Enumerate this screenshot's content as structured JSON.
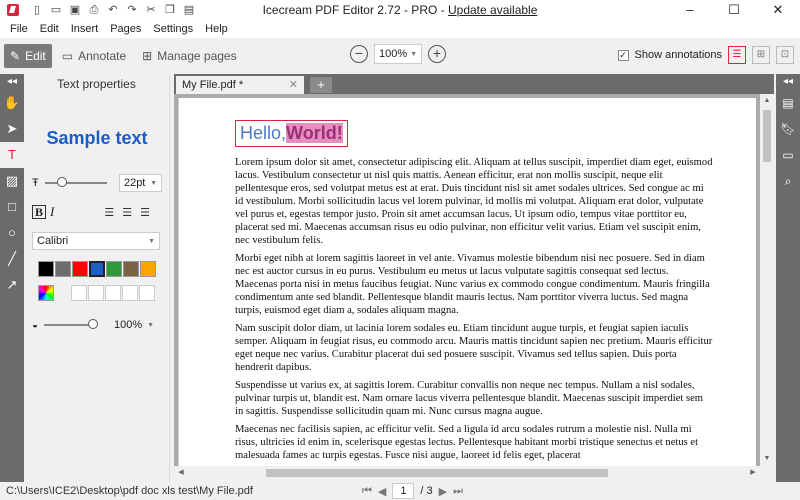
{
  "window": {
    "title": "Icecream PDF Editor 2.72 - PRO - ",
    "update_link": "Update available"
  },
  "menu": [
    "File",
    "Edit",
    "Insert",
    "Pages",
    "Settings",
    "Help"
  ],
  "toolbar": {
    "edit_label": "Edit",
    "annotate_label": "Annotate",
    "manage_pages_label": "Manage pages",
    "zoom_value": "100%",
    "show_annotations_label": "Show annotations"
  },
  "text_properties": {
    "title": "Text properties",
    "sample_text": "Sample text",
    "font_size": "22pt",
    "font_family": "Calibri",
    "opacity": "100%",
    "swatch_colors": [
      "#000000",
      "#6d6d6d",
      "#ff0000",
      "#1f5fc9",
      "#2e9a3a",
      "#7b6446",
      "#ffa500"
    ]
  },
  "tab": {
    "name": "My File.pdf *"
  },
  "document": {
    "hello_text": "Hello,",
    "world_text": "World!",
    "paragraphs": [
      "Lorem ipsum dolor sit amet, consectetur adipiscing elit. Aliquam at tellus suscipit, imperdiet diam eget, euismod lacus. Vestibulum consectetur ut nisl quis mattis. Aenean efficitur, erat non mollis suscipit, neque elit pellentesque eros, sed volutpat metus est at erat. Duis tincidunt nisl sit amet sodales ultrices. Sed congue ac mi id vestibulum. Morbi sollicitudin lacus vel lorem pulvinar, id mollis mi volutpat. Aliquam erat dolor, vulputate vel purus et, egestas tempor justo. Proin sit amet accumsan lacus. Ut ipsum odio, tempus vitae porttitor eu, placerat sed mi. Maecenas accumsan risus eu odio pulvinar, non efficitur velit varius. Etiam vel suscipit enim, nec vestibulum felis.",
      "Morbi eget nibh at lorem sagittis laoreet in vel ante. Vivamus molestie bibendum nisi nec posuere. Sed in diam nec est auctor cursus in eu purus. Vestibulum eu metus ut lacus vulputate sagittis consequat sed lectus. Maecenas porta nisi in metus faucibus feugiat. Nunc varius ex commodo congue condimentum. Mauris fringilla condimentum ante sed blandit. Pellentesque blandit mauris lectus. Nam porttitor viverra luctus. Sed magna turpis, euismod eget diam a, sodales aliquam magna.",
      "Nam suscipit dolor diam, ut lacinia lorem sodales eu. Etiam tincidunt augue turpis, et feugiat sapien iaculis semper. Aliquam in feugiat risus, eu commodo arcu. Mauris mattis tincidunt sapien nec pretium. Mauris efficitur eget neque nec varius. Curabitur placerat dui sed posuere suscipit. Vivamus sed tellus sapien. Duis porta hendrerit dapibus.",
      "Suspendisse ut varius ex, at sagittis lorem. Curabitur convallis non neque nec tempus. Nullam a nisl sodales, pulvinar turpis ut, blandit est. Nam ornare lacus viverra pellentesque blandit. Maecenas suscipit imperdiet sem in sagittis. Suspendisse sollicitudin quam mi. Nunc cursus magna augue.",
      "Maecenas nec facilisis sapien, ac efficitur velit. Sed a ligula id arcu sodales rutrum a molestie nisl. Nulla mi risus, ultricies id enim in, scelerisque egestas lectus. Pellentesque habitant morbi tristique senectus et netus et malesuada fames ac turpis egestas. Fusce nisi augue, laoreet id felis eget, placerat"
    ]
  },
  "status": {
    "file_path": "C:\\Users\\ICE2\\Desktop\\pdf doc xls test\\My File.pdf",
    "current_page": "1",
    "total_pages": "/ 3"
  }
}
